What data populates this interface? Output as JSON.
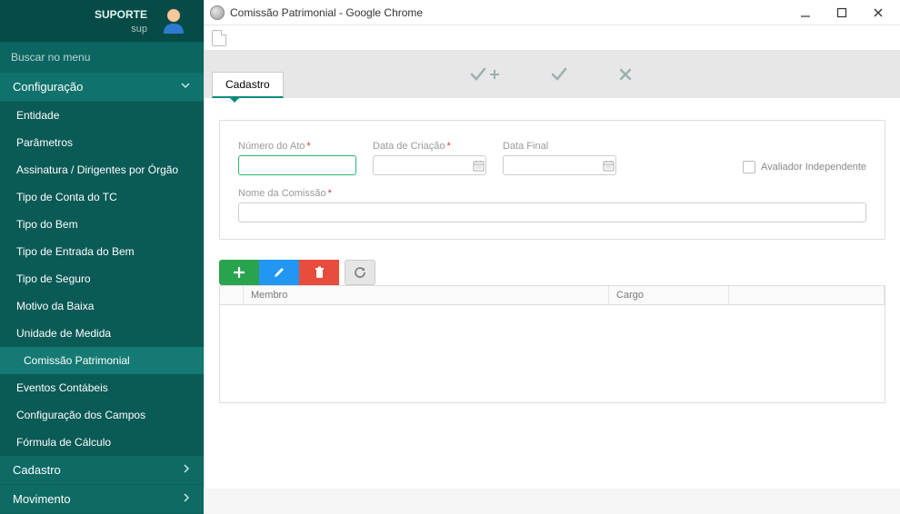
{
  "sidebar": {
    "user_top": "SUPORTE",
    "user_sub": "sup",
    "search_placeholder": "Buscar no menu",
    "groups": {
      "configuracao": "Configuração",
      "cadastro": "Cadastro",
      "movimento": "Movimento"
    },
    "items": [
      "Entidade",
      "Parâmetros",
      "Assinatura / Dirigentes por Órgão",
      "Tipo de Conta do TC",
      "Tipo do Bem",
      "Tipo de Entrada do Bem",
      "Tipo de Seguro",
      "Motivo da Baixa",
      "Unidade de Medida",
      "Comissão Patrimonial",
      "Eventos Contábeis",
      "Configuração dos Campos",
      "Fórmula de Cálculo"
    ]
  },
  "window": {
    "title": "Comissão Patrimonial - Google Chrome"
  },
  "tab_label": "Cadastro",
  "form": {
    "numero_ato_label": "Número do Ato",
    "data_criacao_label": "Data de Criação",
    "data_final_label": "Data Final",
    "nome_comissao_label": "Nome da Comissão",
    "avaliador_label": "Avaliador Independente"
  },
  "grid": {
    "col_membro": "Membro",
    "col_cargo": "Cargo"
  }
}
